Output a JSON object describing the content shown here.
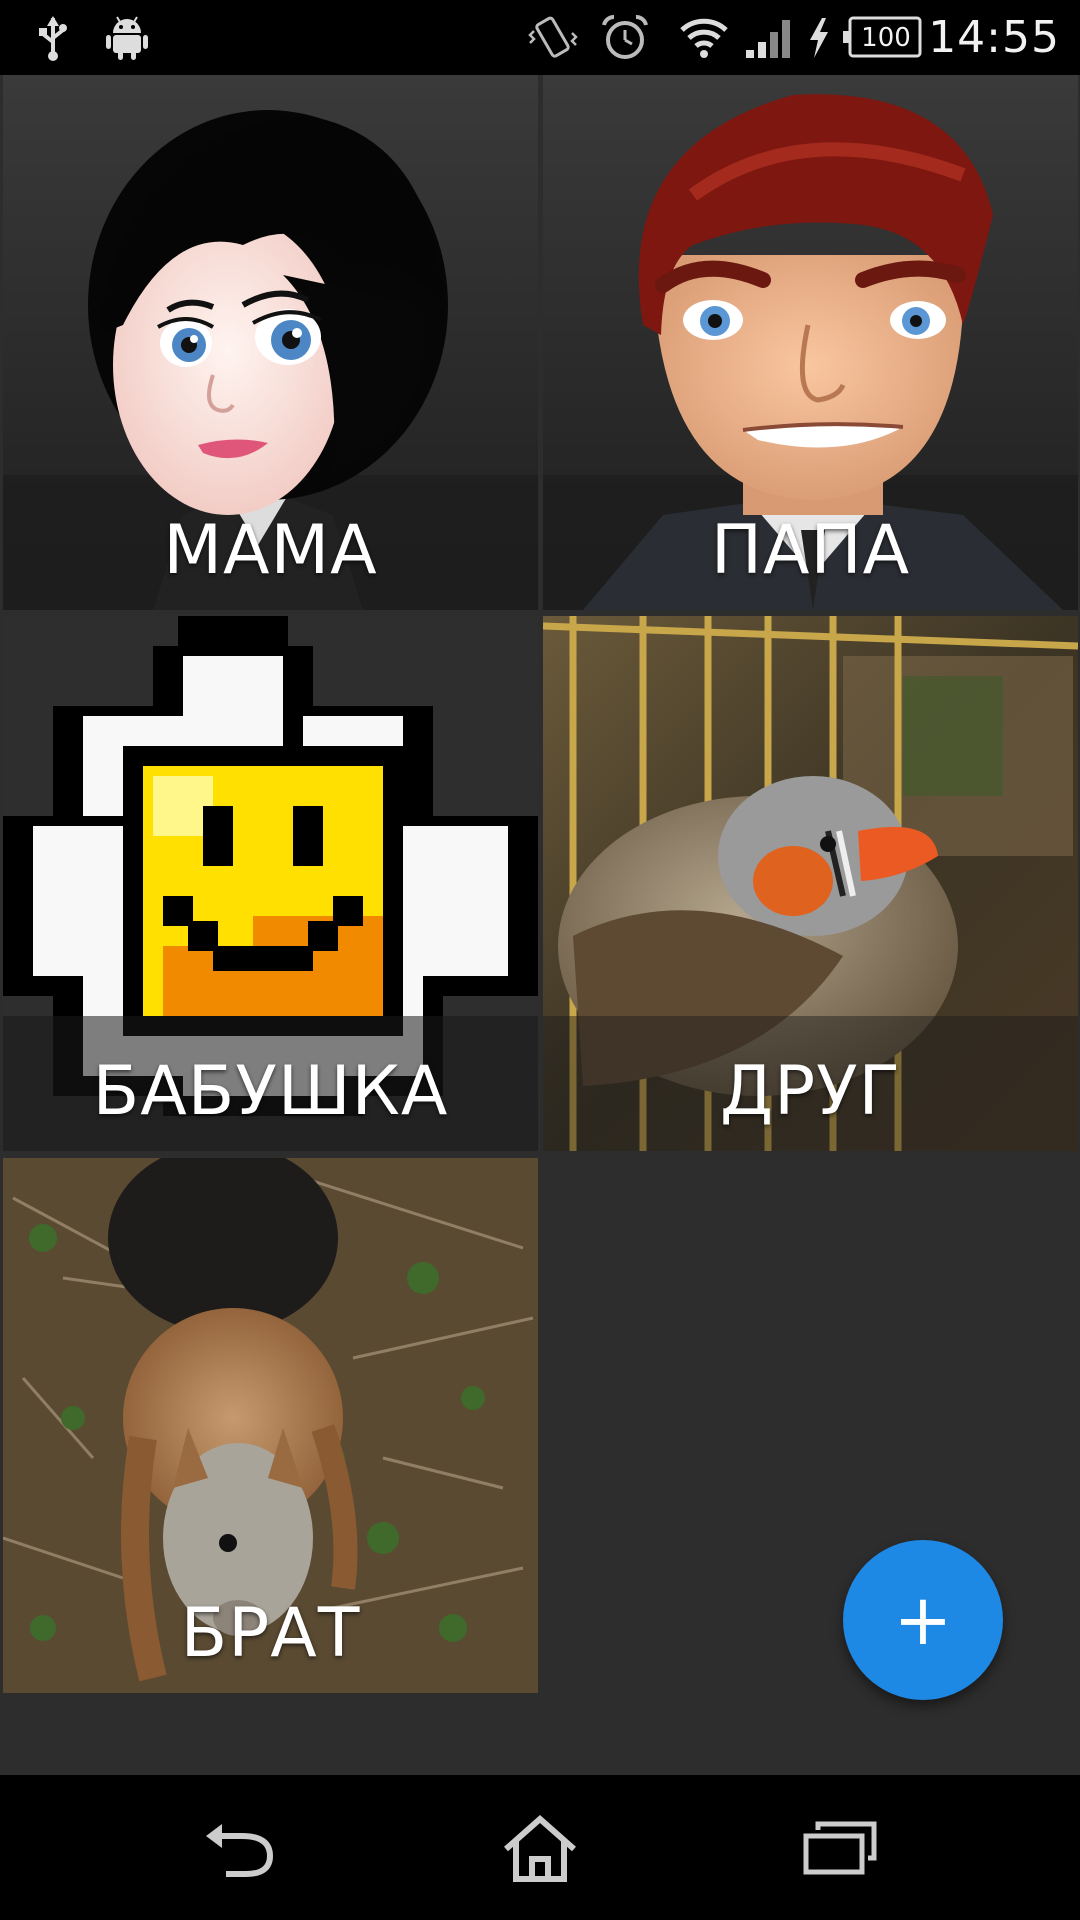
{
  "status_bar": {
    "time": "14:55",
    "battery_level": "100",
    "icons": [
      "usb-icon",
      "android-debug-icon",
      "vibrate-icon",
      "alarm-icon",
      "wifi-icon",
      "signal-icon",
      "charging-icon",
      "battery-icon"
    ]
  },
  "contacts": [
    {
      "label": "МАМА",
      "image": "cartoon-woman-portrait"
    },
    {
      "label": "ПАПА",
      "image": "cartoon-man-portrait"
    },
    {
      "label": "БАБУШКА",
      "image": "pixel-smiley-daisy"
    },
    {
      "label": "ДРУГ",
      "image": "finch-bird-photo"
    },
    {
      "label": "БРАТ",
      "image": "squirrel-photo"
    }
  ],
  "fab": {
    "label": "+",
    "icon": "plus-icon",
    "color": "#1e88e5"
  },
  "nav_bar": {
    "buttons": [
      "back-icon",
      "home-icon",
      "recent-apps-icon"
    ]
  },
  "colors": {
    "background": "#2d2d2d",
    "system_bars": "#000000",
    "accent": "#1e88e5"
  }
}
